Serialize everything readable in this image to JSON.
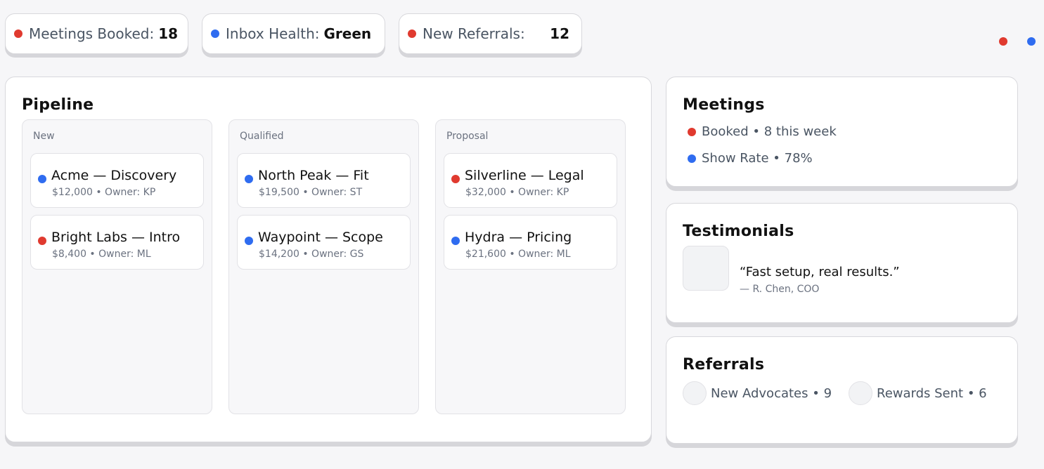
{
  "kpis": [
    {
      "label": "Meetings Booked:",
      "value": "18",
      "dot": "red"
    },
    {
      "label": "Inbox Health:",
      "value": "Green",
      "dot": "blue"
    },
    {
      "label": "New Referrals:",
      "value": "12",
      "dot": "red"
    }
  ],
  "colors": {
    "red": "#e03a2f",
    "blue": "#2f6cf0"
  },
  "pipeline": {
    "title": "Pipeline",
    "columns": [
      {
        "title": "New",
        "deals": [
          {
            "name": "Acme — Discovery",
            "meta": "$12,000 • Owner: KP",
            "dot": "blue"
          },
          {
            "name": "Bright Labs — Intro",
            "meta": "$8,400 • Owner: ML",
            "dot": "red"
          }
        ]
      },
      {
        "title": "Qualified",
        "deals": [
          {
            "name": "North Peak — Fit",
            "meta": "$19,500 • Owner: ST",
            "dot": "blue"
          },
          {
            "name": "Waypoint — Scope",
            "meta": "$14,200 • Owner: GS",
            "dot": "blue"
          }
        ]
      },
      {
        "title": "Proposal",
        "deals": [
          {
            "name": "Silverline — Legal",
            "meta": "$32,000 • Owner: KP",
            "dot": "red"
          },
          {
            "name": "Hydra — Pricing",
            "meta": "$21,600 • Owner: ML",
            "dot": "blue"
          }
        ]
      }
    ]
  },
  "meetings": {
    "title": "Meetings",
    "rows": [
      {
        "text": "Booked • 8 this week",
        "dot": "red"
      },
      {
        "text": "Show Rate • 78%",
        "dot": "blue"
      }
    ]
  },
  "testimonials": {
    "title": "Testimonials",
    "quote": "“Fast setup, real results.”",
    "author": "— R. Chen, COO"
  },
  "referrals": {
    "title": "Referrals",
    "items": [
      {
        "text": "New Advocates • 9"
      },
      {
        "text": "Rewards Sent • 6"
      }
    ]
  }
}
